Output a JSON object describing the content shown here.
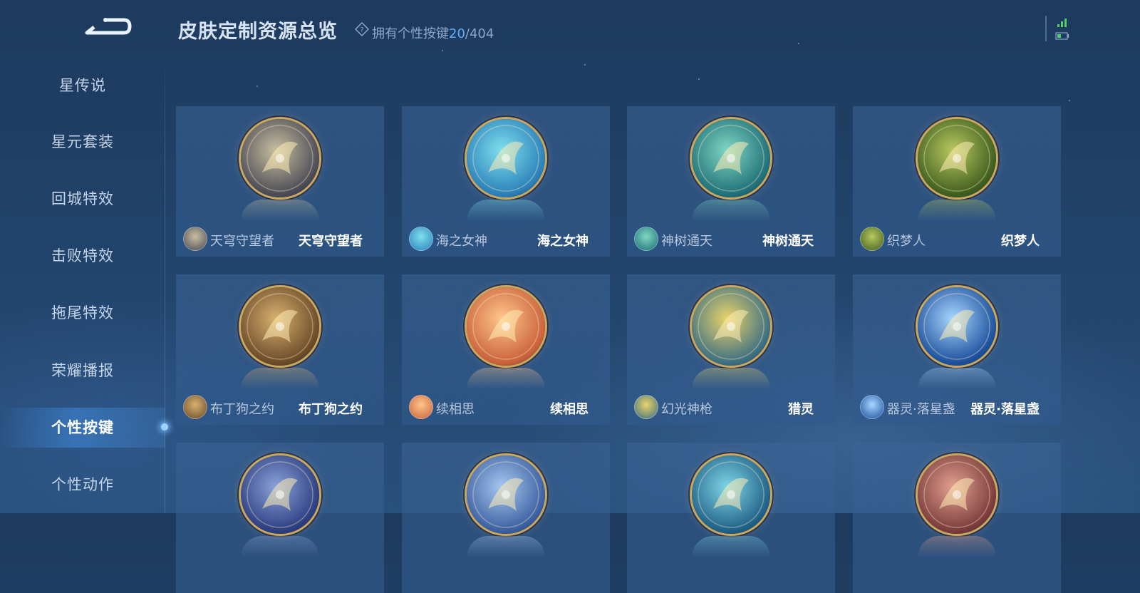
{
  "header": {
    "title": "皮肤定制资源总览",
    "owned_prefix": "拥有个性按键",
    "owned_current": "20",
    "owned_total": "/404"
  },
  "sidebar": {
    "items": [
      {
        "label": "星传说"
      },
      {
        "label": "星元套装"
      },
      {
        "label": "回城特效"
      },
      {
        "label": "击败特效"
      },
      {
        "label": "拖尾特效"
      },
      {
        "label": "荣耀播报"
      },
      {
        "label": "个性按键",
        "active": true
      },
      {
        "label": "个性动作"
      }
    ]
  },
  "cards": [
    {
      "hero": "天穹守望者",
      "skin": "天穹守望者",
      "icon": "bow-emblem-icon",
      "colors": [
        "#c8bfa0",
        "#4a4a55"
      ]
    },
    {
      "hero": "海之女神",
      "skin": "海之女神",
      "icon": "flower-emblem-icon",
      "colors": [
        "#7fe0ee",
        "#2a7fb8"
      ]
    },
    {
      "hero": "神树通天",
      "skin": "神树通天",
      "icon": "vine-bow-emblem-icon",
      "colors": [
        "#7fd6c2",
        "#1f6f78"
      ]
    },
    {
      "hero": "织梦人",
      "skin": "织梦人",
      "icon": "dragon-emblem-icon",
      "colors": [
        "#b9c860",
        "#3e5d1e"
      ]
    },
    {
      "hero": "布丁狗之约",
      "skin": "布丁狗之约",
      "icon": "ribbon-emblem-icon",
      "colors": [
        "#d8b070",
        "#6a4a28"
      ]
    },
    {
      "hero": "续相思",
      "skin": "续相思",
      "icon": "lotus-emblem-icon",
      "colors": [
        "#ffc68a",
        "#c9613a"
      ]
    },
    {
      "hero": "幻光神枪",
      "skin": "猎灵",
      "icon": "spear-emblem-icon",
      "colors": [
        "#e9d46a",
        "#3b6e82"
      ]
    },
    {
      "hero": "器灵·落星盏",
      "skin": "器灵·落星盏",
      "icon": "lamp-emblem-icon",
      "colors": [
        "#a8d6ff",
        "#1b4f9c"
      ]
    },
    {
      "hero": "",
      "skin": "",
      "icon": "pagoda-emblem-icon",
      "colors": [
        "#8aa2d8",
        "#2c3d80"
      ]
    },
    {
      "hero": "",
      "skin": "",
      "icon": "petal-emblem-icon",
      "colors": [
        "#a7c7f0",
        "#3a5fa0"
      ]
    },
    {
      "hero": "",
      "skin": "",
      "icon": "wave-emblem-icon",
      "colors": [
        "#7fd6e6",
        "#1f5f86"
      ]
    },
    {
      "hero": "",
      "skin": "",
      "icon": "blade-emblem-icon",
      "colors": [
        "#e0a090",
        "#7a3a3a"
      ]
    }
  ]
}
